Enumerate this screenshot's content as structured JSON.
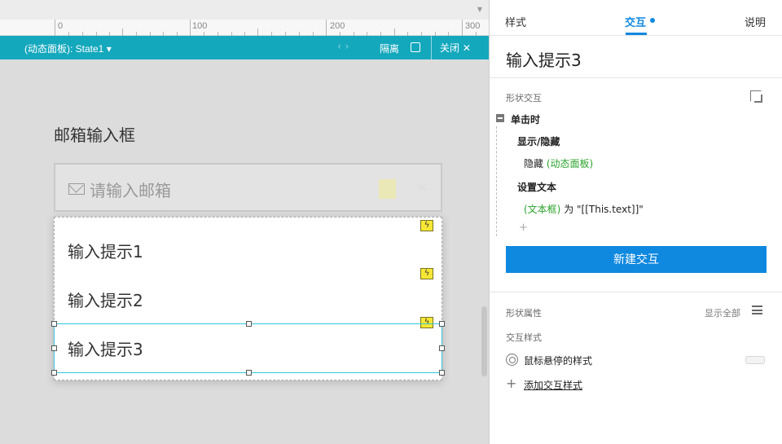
{
  "ruler": {
    "labels": [
      "0",
      "100",
      "200",
      "300"
    ]
  },
  "panel_bar": {
    "state_label": "(动态面板): State1 ▾",
    "nav": "‹ ›",
    "isolate_label": "隔离",
    "close_label": "关闭 ✕"
  },
  "canvas": {
    "email_title": "邮箱输入框",
    "email_placeholder": "请输入邮箱",
    "clear_glyph": "×",
    "hints": [
      "输入提示1",
      "输入提示2",
      "输入提示3"
    ],
    "bolt_glyph": "ϟ"
  },
  "right_panel": {
    "tabs": [
      "样式",
      "交互",
      "说明"
    ],
    "active_tab": "交互",
    "item_name": "输入提示3",
    "section_interactions": "形状交互",
    "event": "单击时",
    "actions": [
      {
        "title": "显示/隐藏",
        "verb": "隐藏 ",
        "target": "(动态面板)",
        "suffix": ""
      },
      {
        "title": "设置文本",
        "verb": "",
        "target": "(文本框)",
        "suffix": " 为 \"[[This.text]]\""
      }
    ],
    "add_glyph": "+",
    "new_interaction_button": "新建交互",
    "section_properties": "形状属性",
    "show_all": "显示全部",
    "section_styles": "交互样式",
    "hover_style": "鼠标悬停的样式",
    "add_style_glyph": "+",
    "add_style": "添加交互样式"
  },
  "colors": {
    "accent": "#0f88e0",
    "panel_bar": "#14a8bd",
    "green_target": "#2ca32c",
    "bolt_yellow": "#f7e735",
    "selection": "#33c9dd"
  }
}
